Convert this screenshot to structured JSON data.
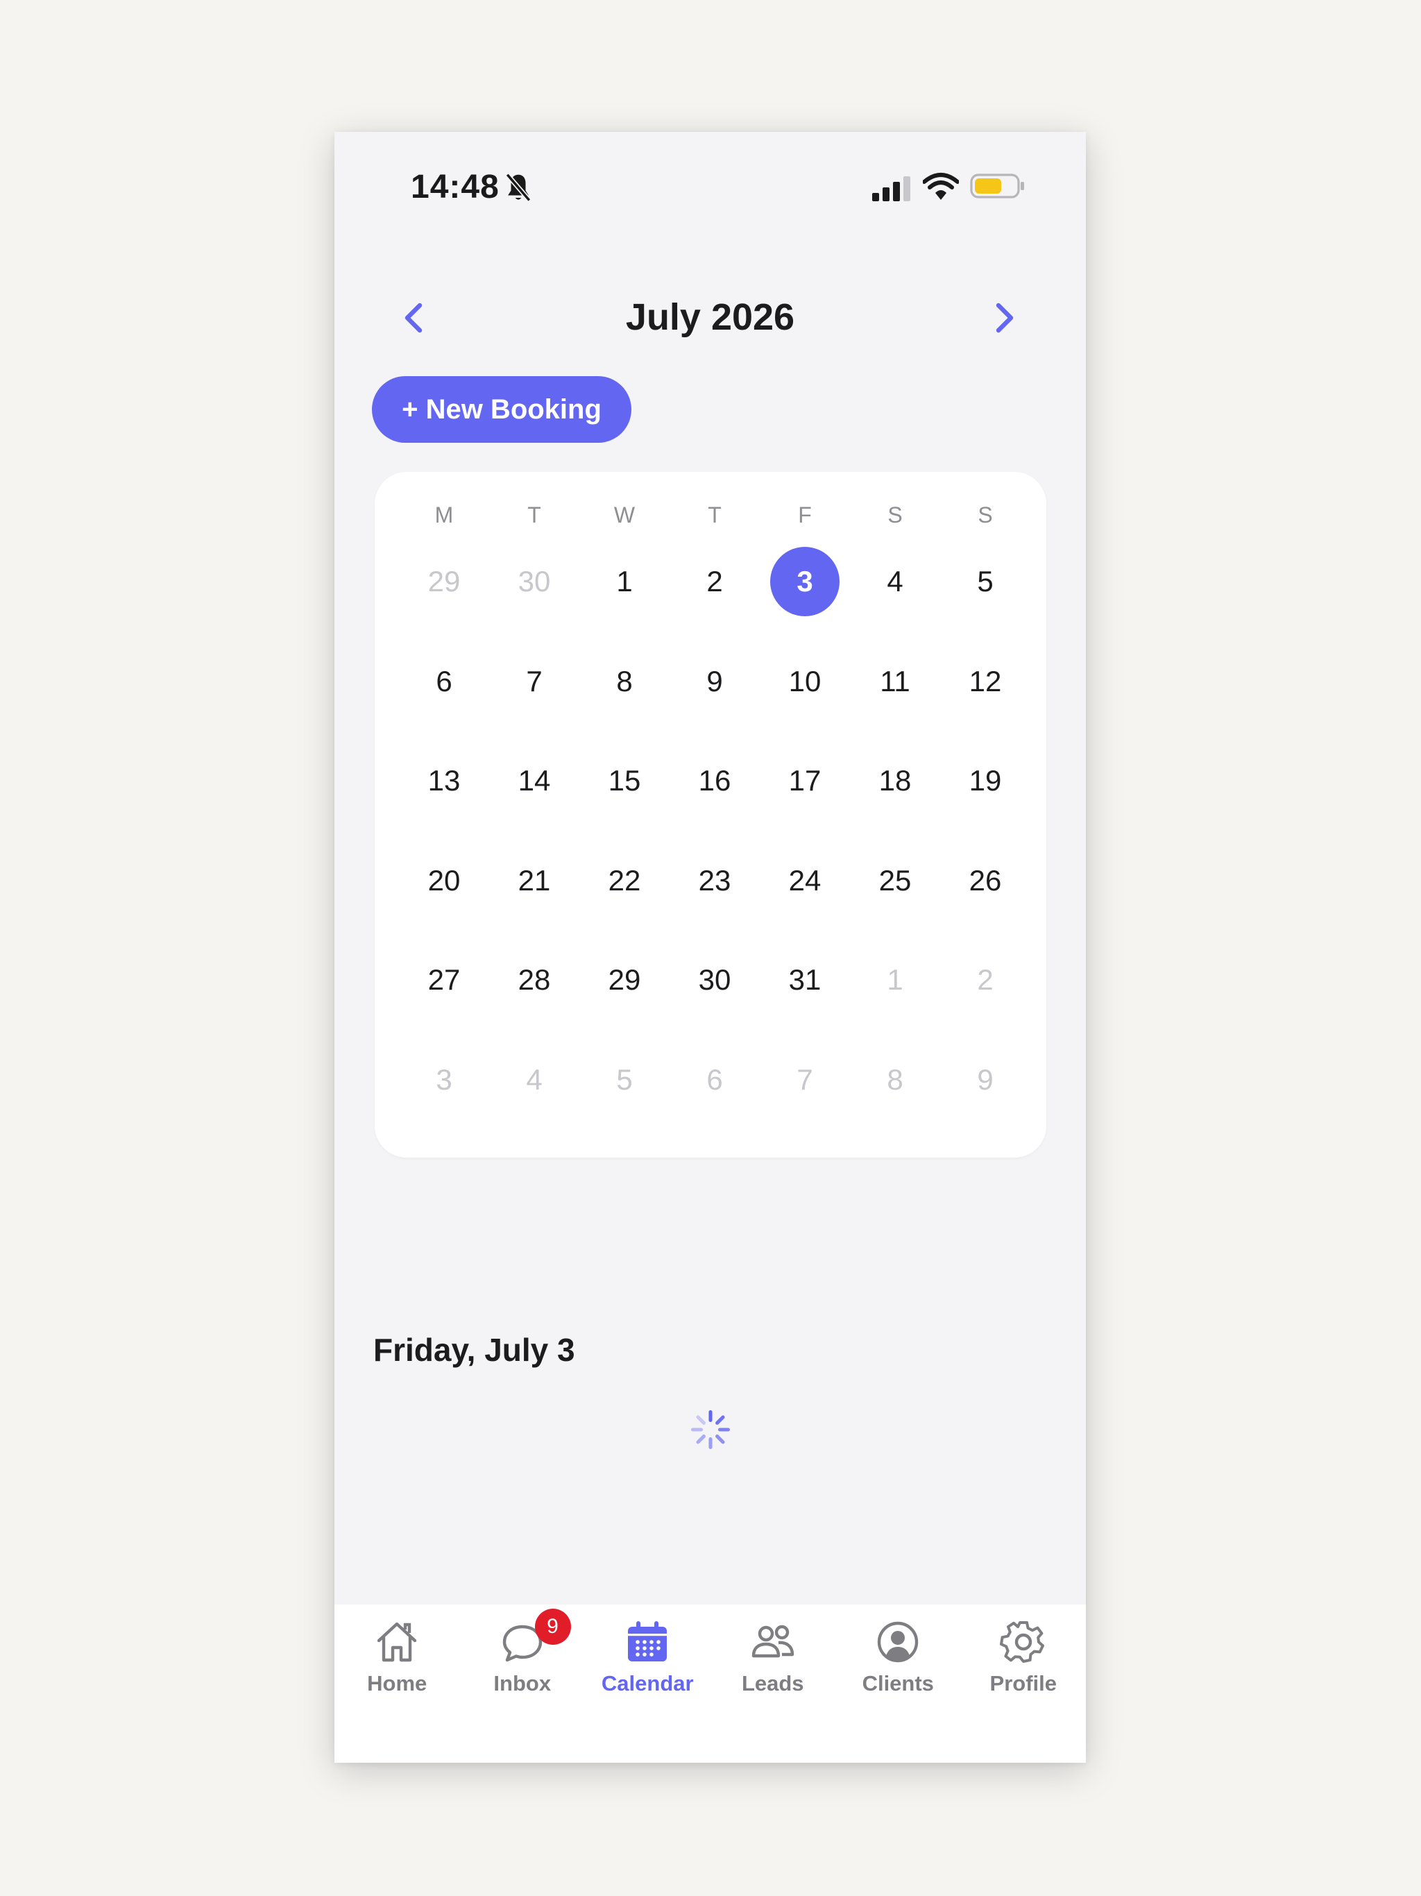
{
  "status_bar": {
    "time": "14:48"
  },
  "header": {
    "month_title": "July 2026"
  },
  "actions": {
    "new_booking_label": "+ New Booking"
  },
  "calendar": {
    "weekdays": [
      "M",
      "T",
      "W",
      "T",
      "F",
      "S",
      "S"
    ],
    "days": [
      {
        "label": "29",
        "muted": true
      },
      {
        "label": "30",
        "muted": true
      },
      {
        "label": "1"
      },
      {
        "label": "2"
      },
      {
        "label": "3",
        "selected": true
      },
      {
        "label": "4"
      },
      {
        "label": "5"
      },
      {
        "label": "6"
      },
      {
        "label": "7"
      },
      {
        "label": "8"
      },
      {
        "label": "9"
      },
      {
        "label": "10"
      },
      {
        "label": "11"
      },
      {
        "label": "12"
      },
      {
        "label": "13"
      },
      {
        "label": "14"
      },
      {
        "label": "15"
      },
      {
        "label": "16"
      },
      {
        "label": "17"
      },
      {
        "label": "18"
      },
      {
        "label": "19"
      },
      {
        "label": "20"
      },
      {
        "label": "21"
      },
      {
        "label": "22"
      },
      {
        "label": "23"
      },
      {
        "label": "24"
      },
      {
        "label": "25"
      },
      {
        "label": "26"
      },
      {
        "label": "27"
      },
      {
        "label": "28"
      },
      {
        "label": "29"
      },
      {
        "label": "30"
      },
      {
        "label": "31"
      },
      {
        "label": "1",
        "muted": true
      },
      {
        "label": "2",
        "muted": true
      },
      {
        "label": "3",
        "muted": true
      },
      {
        "label": "4",
        "muted": true
      },
      {
        "label": "5",
        "muted": true
      },
      {
        "label": "6",
        "muted": true
      },
      {
        "label": "7",
        "muted": true
      },
      {
        "label": "8",
        "muted": true
      },
      {
        "label": "9",
        "muted": true
      }
    ]
  },
  "selected_day": {
    "heading": "Friday, July 3"
  },
  "tabbar": {
    "items": [
      {
        "label": "Home",
        "icon": "home-icon"
      },
      {
        "label": "Inbox",
        "icon": "chat-icon",
        "badge": "9"
      },
      {
        "label": "Calendar",
        "icon": "calendar-icon",
        "active": true
      },
      {
        "label": "Leads",
        "icon": "people-icon"
      },
      {
        "label": "Clients",
        "icon": "user-circle-icon"
      },
      {
        "label": "Profile",
        "icon": "gear-icon"
      }
    ]
  },
  "colors": {
    "accent": "#6366f1",
    "badge": "#e11d2a",
    "battery": "#f5c518"
  }
}
